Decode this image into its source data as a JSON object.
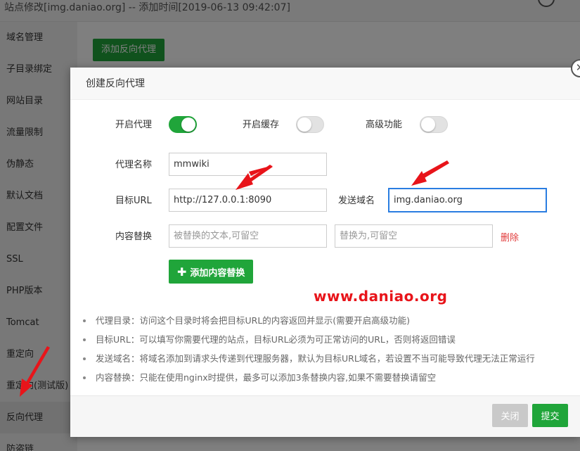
{
  "window": {
    "title": "站点修改[img.daniao.org] -- 添加时间[2019-06-13 09:42:07]"
  },
  "sidebar": {
    "items": [
      {
        "label": "域名管理"
      },
      {
        "label": "子目录绑定"
      },
      {
        "label": "网站目录"
      },
      {
        "label": "流量限制"
      },
      {
        "label": "伪静态"
      },
      {
        "label": "默认文档"
      },
      {
        "label": "配置文件"
      },
      {
        "label": "SSL"
      },
      {
        "label": "PHP版本"
      },
      {
        "label": "Tomcat"
      },
      {
        "label": "重定向"
      },
      {
        "label": "重定向(测试版)"
      },
      {
        "label": "反向代理"
      },
      {
        "label": "防盗链"
      }
    ],
    "active_index": 12
  },
  "background": {
    "add_proxy_button": "添加反向代理"
  },
  "modal": {
    "title": "创建反向代理",
    "toggles": {
      "proxy": {
        "label": "开启代理",
        "on": true
      },
      "cache": {
        "label": "开启缓存",
        "on": false
      },
      "advanced": {
        "label": "高级功能",
        "on": false
      }
    },
    "proxy_name": {
      "label": "代理名称",
      "value": "mmwiki"
    },
    "target_url": {
      "label": "目标URL",
      "value": "http://127.0.0.1:8090"
    },
    "send_domain": {
      "label": "发送域名",
      "value": "img.daniao.org"
    },
    "content_replace": {
      "label": "内容替换",
      "from_placeholder": "被替换的文本,可留空",
      "to_placeholder": "替换为,可留空",
      "delete_label": "删除"
    },
    "add_replace_button": "添加内容替换",
    "tips": [
      "代理目录：访问这个目录时将会把目标URL的内容返回并显示(需要开启高级功能)",
      "目标URL：可以填写你需要代理的站点，目标URL必须为可正常访问的URL，否则将返回错误",
      "发送域名：将域名添加到请求头传递到代理服务器，默认为目标URL域名，若设置不当可能导致代理无法正常运行",
      "内容替换：只能在使用nginx时提供，最多可以添加3条替换内容,如果不需要替换请留空"
    ],
    "footer": {
      "close_label": "关闭",
      "submit_label": "提交"
    }
  },
  "watermark": "www.daniao.org",
  "colors": {
    "accent_green": "#20a53a",
    "danger_red": "#e13b3b",
    "annotation_arrow": "#e8141a",
    "focus_blue": "#2a7de1"
  }
}
